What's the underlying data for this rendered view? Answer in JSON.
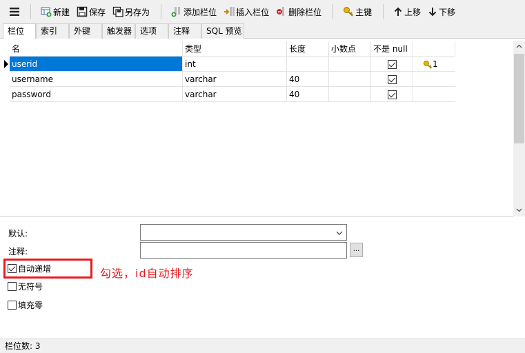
{
  "toolbar": {
    "new_label": "新建",
    "save_label": "保存",
    "save_as_label": "另存为",
    "add_field_label": "添加栏位",
    "insert_field_label": "插入栏位",
    "delete_field_label": "删除栏位",
    "primary_key_label": "主键",
    "move_up_label": "上移",
    "move_down_label": "下移"
  },
  "tabs": [
    "栏位",
    "索引",
    "外键",
    "触发器",
    "选项",
    "注释",
    "SQL 预览"
  ],
  "grid": {
    "headers": [
      "名",
      "类型",
      "长度",
      "小数点",
      "不是 null",
      ""
    ],
    "rows": [
      {
        "name": "userid",
        "type": "int",
        "length": "",
        "decimals": "",
        "not_null": true,
        "key": "1"
      },
      {
        "name": "username",
        "type": "varchar",
        "length": "40",
        "decimals": "",
        "not_null": true,
        "key": ""
      },
      {
        "name": "password",
        "type": "varchar",
        "length": "40",
        "decimals": "",
        "not_null": true,
        "key": ""
      }
    ]
  },
  "properties": {
    "default_label": "默认:",
    "default_value": "",
    "comment_label": "注释:",
    "comment_value": "",
    "comment_button": "...",
    "auto_increment_label": "自动递增",
    "auto_increment_checked": true,
    "unsigned_label": "无符号",
    "unsigned_checked": false,
    "zerofill_label": "填充零",
    "zerofill_checked": false
  },
  "annotation": {
    "text": "勾选，id自动排序",
    "color": "#e8191d"
  },
  "status": {
    "field_count": "栏位数: 3"
  },
  "colors": {
    "selection": "#0078d7",
    "chrome": "#f0f0f0"
  }
}
